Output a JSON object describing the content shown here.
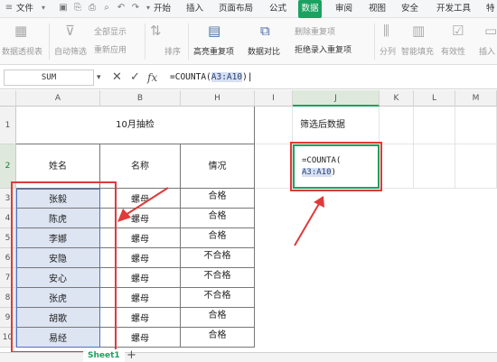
{
  "menubar": {
    "file_menu": "文件",
    "tabs": [
      "开始",
      "插入",
      "页面布局",
      "公式",
      "数据",
      "审阅",
      "视图",
      "安全",
      "开发工具",
      "特"
    ],
    "active_tab": "数据"
  },
  "ribbon": {
    "pivot": "数据透视表",
    "auto_filter": "自动筛选",
    "show_all": "全部显示",
    "reapply": "重新应用",
    "sort": "排序",
    "highlight_dup": "高亮重复项",
    "data_compare": "数据对比",
    "delete_dup": "删除重复项",
    "reject_dup": "拒绝录入重复项",
    "split": "分列",
    "smart_fill": "智能填充",
    "validity": "有效性",
    "insert": "插入"
  },
  "formula_bar": {
    "name_box": "SUM",
    "formula_prefix": "=COUNTA(",
    "formula_ref": "A3:A10",
    "formula_suffix": ")"
  },
  "sheet": {
    "columns": [
      "A",
      "B",
      "H",
      "I",
      "J",
      "K",
      "L",
      "M"
    ],
    "rows": [
      "1",
      "2",
      "3",
      "4",
      "5",
      "6",
      "7",
      "8",
      "9",
      "10"
    ],
    "title": "10月抽检",
    "headers": [
      "姓名",
      "名称",
      "情况"
    ],
    "names": [
      "张毅",
      "陈虎",
      "李娜",
      "安隐",
      "安心",
      "张虎",
      "胡歌",
      "易经"
    ],
    "products": [
      "螺母",
      "螺母",
      "螺母",
      "螺母",
      "螺母",
      "螺母",
      "螺母",
      "螺母"
    ],
    "status": [
      "合格",
      "合格",
      "合格",
      "不合格",
      "不合格",
      "不合格",
      "合格",
      "合格"
    ],
    "j1_label": "筛选后数据",
    "j2_line1": "=COUNTA(",
    "j2_ref": "A3:A10",
    "j2_close": ")"
  },
  "sheet_tabs": {
    "active": "Sheet1",
    "add": "+"
  }
}
